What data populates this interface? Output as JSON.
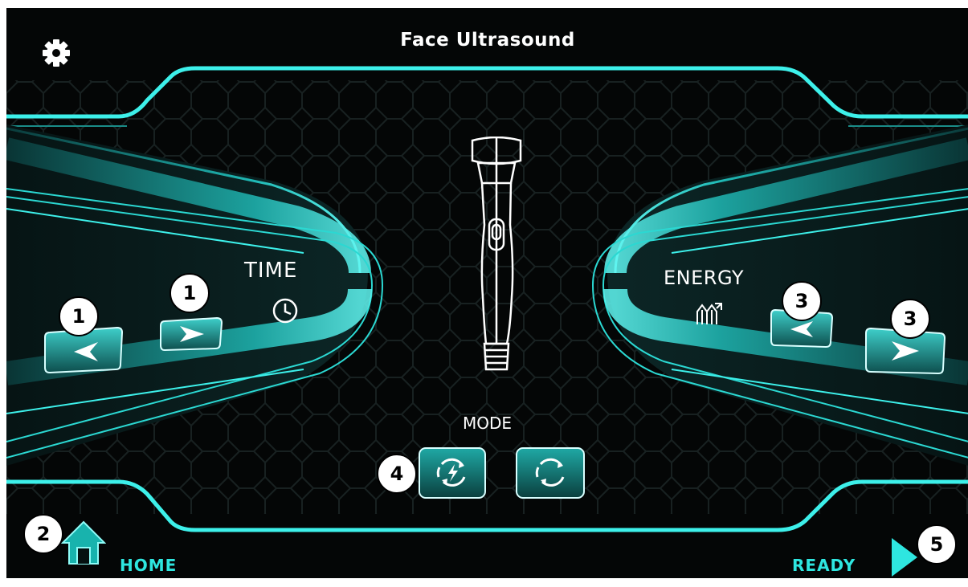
{
  "header": {
    "title": "Face Ultrasound",
    "settings_icon": "gear-icon"
  },
  "time": {
    "label": "TIME",
    "icon": "clock-icon",
    "decrease_icon": "arrow-left-icon",
    "increase_icon": "arrow-right-icon"
  },
  "energy": {
    "label": "ENERGY",
    "icon": "energy-chart-icon",
    "decrease_icon": "arrow-left-icon",
    "increase_icon": "arrow-right-icon"
  },
  "handpiece": {
    "icon": "ultrasound-handpiece-icon"
  },
  "mode": {
    "label": "MODE",
    "options": [
      "pulse-mode-icon",
      "continuous-mode-icon"
    ]
  },
  "footer": {
    "home_label": "HOME",
    "ready_label": "READY",
    "home_icon": "home-icon",
    "ready_icon": "play-icon"
  },
  "callouts": {
    "time": "1",
    "home": "2",
    "energy": "3",
    "mode": "4",
    "ready": "5"
  },
  "colors": {
    "accent": "#2ee6e0",
    "background": "#040606",
    "text": "#ffffff"
  }
}
